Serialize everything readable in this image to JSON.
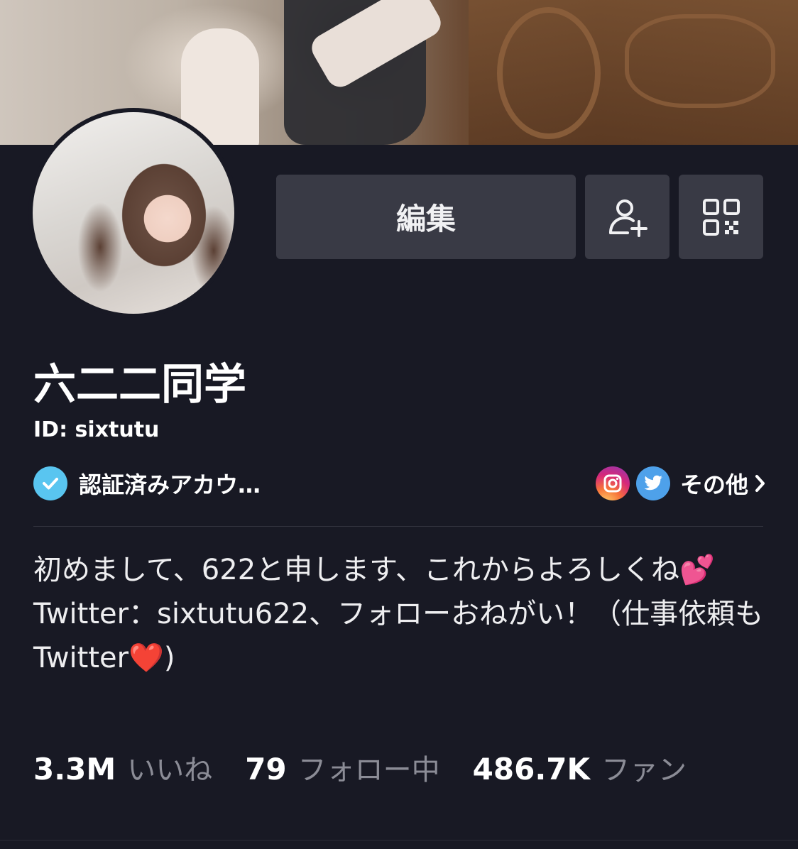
{
  "profile": {
    "display_name": "六二二同学",
    "id_text": "ID: sixtutu",
    "verified_label": "認証済みアカウ…",
    "more_label": "その他",
    "bio": "初めまして、622と申します、これからよろしくね💕\nTwitter：sixtutu622、フォローおねがい！（仕事依頼もTwitter❤️)"
  },
  "actions": {
    "edit_label": "編集"
  },
  "stats": [
    {
      "value": "3.3M",
      "label": "いいね"
    },
    {
      "value": "79",
      "label": "フォロー中"
    },
    {
      "value": "486.7K",
      "label": "ファン"
    }
  ],
  "icons": {
    "add_friend": "add-user-icon",
    "qr": "qr-code-icon",
    "verified": "verified-check-icon",
    "instagram": "instagram-icon",
    "twitter": "twitter-icon",
    "chevron": "chevron-right-icon"
  },
  "colors": {
    "background": "#181924",
    "button": "#393a45",
    "verified": "#59c5f0",
    "twitter": "#4ea1ea",
    "muted_text": "#8b8c96"
  }
}
